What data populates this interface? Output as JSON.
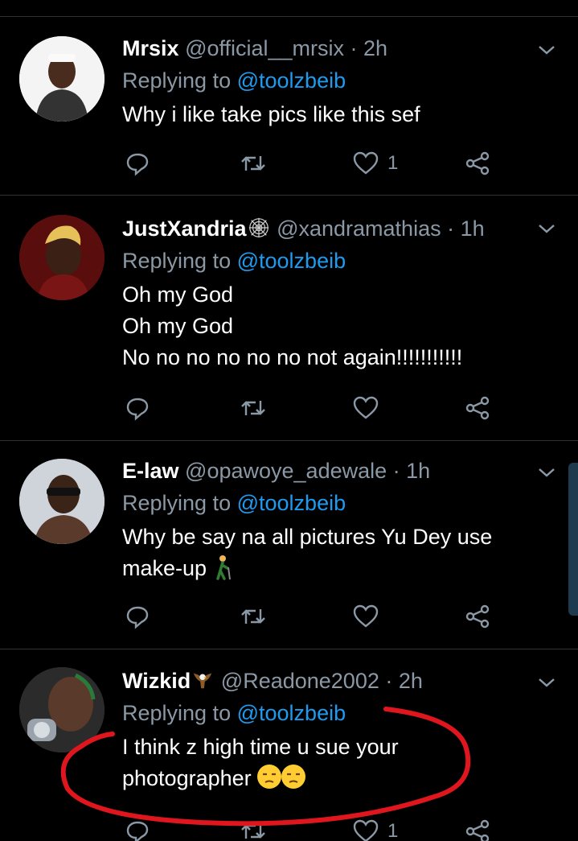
{
  "tweets": [
    {
      "name": "Mrsix",
      "handle": "@official__mrsix",
      "time": "· 2h",
      "replying_prefix": "Replying to",
      "replying_to": "@toolzbeib",
      "body": [
        "Why i like take pics like this sef"
      ],
      "like_count": "1",
      "colors": {
        "avatar_bg": "#f4f4f4",
        "skin": "#4a2c1f"
      }
    },
    {
      "name": "JustXandria",
      "name_badge": "spider-web-icon",
      "handle": "@xandramathias",
      "time": "· 1h",
      "replying_prefix": "Replying to",
      "replying_to": "@toolzbeib",
      "body": [
        "Oh my God",
        "Oh my God",
        "No no no no no no not again!!!!!!!!!!!"
      ],
      "like_count": "",
      "colors": {
        "avatar_bg": "#5a0d0d",
        "hair": "#e6c15a"
      }
    },
    {
      "name": "E-law",
      "handle": "@opawoye_adewale",
      "time": "· 1h",
      "replying_prefix": "Replying to",
      "replying_to": "@toolzbeib",
      "body": [
        "Why be say na all pictures Yu Dey use",
        "make-up"
      ],
      "body_emoji": "person-walking-cane-icon",
      "like_count": "",
      "colors": {
        "avatar_bg": "#cfd4da",
        "skin": "#3a2418"
      }
    },
    {
      "name": "Wizkid",
      "name_badge": "eagle-icon",
      "handle": "@Readone2002",
      "time": "· 2h",
      "replying_prefix": "Replying to",
      "replying_to": "@toolzbeib",
      "body": [
        "I think z high time u sue your",
        "photographer"
      ],
      "body_emoji": "unamused-face-icon",
      "like_count": "1",
      "colors": {
        "avatar_bg": "#2b2b2b",
        "skin": "#5a3a2a"
      }
    }
  ],
  "colors": {
    "background": "#000000",
    "text": "#ffffff",
    "muted": "#8b98a5",
    "mention": "#1d9bf0",
    "divider": "#2f3336",
    "annotation": "#e0161e"
  }
}
